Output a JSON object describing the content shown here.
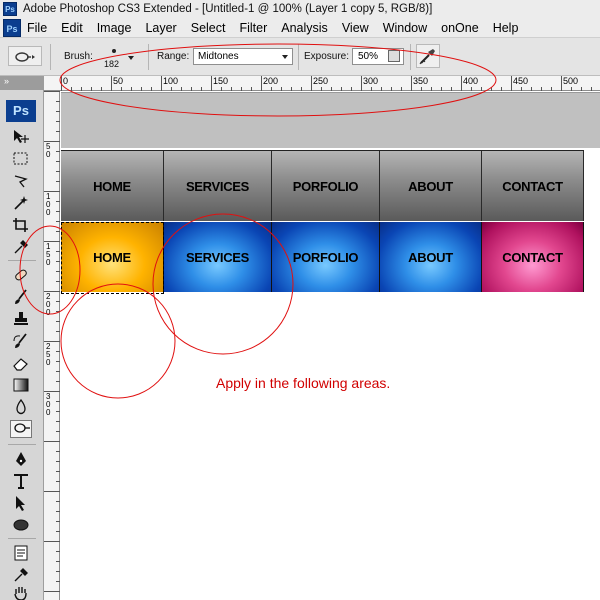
{
  "window": {
    "title": "Adobe Photoshop CS3 Extended - [Untitled-1 @ 100% (Layer 1 copy 5, RGB/8)]",
    "logo_text": "Ps"
  },
  "menu": {
    "items": [
      "File",
      "Edit",
      "Image",
      "Layer",
      "Select",
      "Filter",
      "Analysis",
      "View",
      "Window",
      "onOne",
      "Help"
    ]
  },
  "options_bar": {
    "brush_label": "Brush:",
    "brush_size": "182",
    "range_label": "Range:",
    "range_value": "Midtones",
    "exposure_label": "Exposure:",
    "exposure_value": "50%"
  },
  "tools_panel": {
    "collapse_label": "»",
    "badge": "Ps"
  },
  "ruler": {
    "top_labels": [
      "0",
      "50",
      "100",
      "150",
      "200",
      "250",
      "300",
      "350",
      "400",
      "450",
      "500"
    ],
    "left_labels": [
      "5\n0",
      "1\n0\n0",
      "1\n5\n0",
      "2\n0\n0",
      "2\n5\n0",
      "3\n0\n0"
    ]
  },
  "nav_dark": [
    "HOME",
    "SERVICES",
    "PORFOLIO",
    "ABOUT",
    "CONTACT"
  ],
  "nav_color": [
    "HOME",
    "SERVICES",
    "PORFOLIO",
    "ABOUT",
    "CONTACT"
  ],
  "annotation": "Apply in the following areas.",
  "colors": {
    "annotation_red": "#d10000",
    "home_gold": "#ffb300",
    "nav_blue": "#2f8fe8",
    "contact_pink": "#e2478f",
    "dark_nav": "#5a5a5a"
  }
}
